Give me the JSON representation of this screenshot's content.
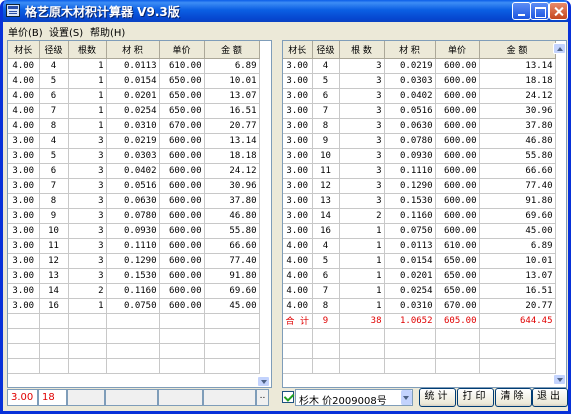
{
  "window": {
    "title": "格艺原木材积计算器 V9.3版"
  },
  "menu": [
    {
      "label": "单价(B)"
    },
    {
      "label": "设置(S)"
    },
    {
      "label": "帮助(H)"
    }
  ],
  "left_table": {
    "headers": [
      "材长",
      "径级",
      "根数",
      "材 积",
      "单价",
      "金 额"
    ],
    "rows": [
      [
        "4.00",
        "4",
        "1",
        "0.0113",
        "610.00",
        "6.89"
      ],
      [
        "4.00",
        "5",
        "1",
        "0.0154",
        "650.00",
        "10.01"
      ],
      [
        "4.00",
        "6",
        "1",
        "0.0201",
        "650.00",
        "13.07"
      ],
      [
        "4.00",
        "7",
        "1",
        "0.0254",
        "650.00",
        "16.51"
      ],
      [
        "4.00",
        "8",
        "1",
        "0.0310",
        "670.00",
        "20.77"
      ],
      [
        "3.00",
        "4",
        "3",
        "0.0219",
        "600.00",
        "13.14"
      ],
      [
        "3.00",
        "5",
        "3",
        "0.0303",
        "600.00",
        "18.18"
      ],
      [
        "3.00",
        "6",
        "3",
        "0.0402",
        "600.00",
        "24.12"
      ],
      [
        "3.00",
        "7",
        "3",
        "0.0516",
        "600.00",
        "30.96"
      ],
      [
        "3.00",
        "8",
        "3",
        "0.0630",
        "600.00",
        "37.80"
      ],
      [
        "3.00",
        "9",
        "3",
        "0.0780",
        "600.00",
        "46.80"
      ],
      [
        "3.00",
        "10",
        "3",
        "0.0930",
        "600.00",
        "55.80"
      ],
      [
        "3.00",
        "11",
        "3",
        "0.1110",
        "600.00",
        "66.60"
      ],
      [
        "3.00",
        "12",
        "3",
        "0.1290",
        "600.00",
        "77.40"
      ],
      [
        "3.00",
        "13",
        "3",
        "0.1530",
        "600.00",
        "91.80"
      ],
      [
        "3.00",
        "14",
        "2",
        "0.1160",
        "600.00",
        "69.60"
      ],
      [
        "3.00",
        "16",
        "1",
        "0.0750",
        "600.00",
        "45.00"
      ]
    ],
    "input_length": "3.00",
    "input_diameter": "18",
    "dots_label": ".."
  },
  "right_table": {
    "headers": [
      "材长",
      "径级",
      "根 数",
      "材 积",
      "单价",
      "金 额"
    ],
    "rows": [
      [
        "3.00",
        "4",
        "3",
        "0.0219",
        "600.00",
        "13.14"
      ],
      [
        "3.00",
        "5",
        "3",
        "0.0303",
        "600.00",
        "18.18"
      ],
      [
        "3.00",
        "6",
        "3",
        "0.0402",
        "600.00",
        "24.12"
      ],
      [
        "3.00",
        "7",
        "3",
        "0.0516",
        "600.00",
        "30.96"
      ],
      [
        "3.00",
        "8",
        "3",
        "0.0630",
        "600.00",
        "37.80"
      ],
      [
        "3.00",
        "9",
        "3",
        "0.0780",
        "600.00",
        "46.80"
      ],
      [
        "3.00",
        "10",
        "3",
        "0.0930",
        "600.00",
        "55.80"
      ],
      [
        "3.00",
        "11",
        "3",
        "0.1110",
        "600.00",
        "66.60"
      ],
      [
        "3.00",
        "12",
        "3",
        "0.1290",
        "600.00",
        "77.40"
      ],
      [
        "3.00",
        "13",
        "3",
        "0.1530",
        "600.00",
        "91.80"
      ],
      [
        "3.00",
        "14",
        "2",
        "0.1160",
        "600.00",
        "69.60"
      ],
      [
        "3.00",
        "16",
        "1",
        "0.0750",
        "600.00",
        "45.00"
      ],
      [
        "4.00",
        "4",
        "1",
        "0.0113",
        "610.00",
        "6.89"
      ],
      [
        "4.00",
        "5",
        "1",
        "0.0154",
        "650.00",
        "10.01"
      ],
      [
        "4.00",
        "6",
        "1",
        "0.0201",
        "650.00",
        "13.07"
      ],
      [
        "4.00",
        "7",
        "1",
        "0.0254",
        "650.00",
        "16.51"
      ],
      [
        "4.00",
        "8",
        "1",
        "0.0310",
        "670.00",
        "20.77"
      ]
    ],
    "total": [
      "合 计",
      "9",
      "38",
      "1.0652",
      "605.00",
      "644.45"
    ]
  },
  "bottom": {
    "checkbox_checked": true,
    "species_select": "杉木 价2009008号",
    "buttons": [
      "统计",
      "打印",
      "清除",
      "退出"
    ]
  },
  "colors": {
    "total_text": "#e00000",
    "title_bar": "#0b5fe3"
  }
}
